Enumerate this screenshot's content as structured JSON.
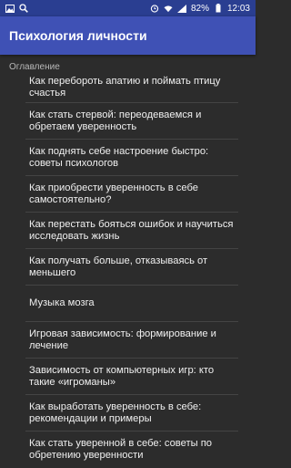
{
  "status_bar": {
    "battery": "82%",
    "time": "12:03",
    "left_icons": [
      "image-icon",
      "search-icon"
    ],
    "right_icons": [
      "alarm-icon",
      "wifi-icon",
      "signal-icon",
      "battery-icon"
    ]
  },
  "app_bar": {
    "title": "Психология личности"
  },
  "toc": {
    "header": "Оглавление",
    "items": [
      {
        "label": "Как перебороть апатию и поймать птицу счастья"
      },
      {
        "label": "Как стать стервой: переодеваемся и обретаем уверенность"
      },
      {
        "label": "Как поднять себе настроение быстро: советы психологов"
      },
      {
        "label": "Как приобрести уверенность в себе самостоятельно?"
      },
      {
        "label": "Как перестать бояться ошибок и научиться исследовать жизнь"
      },
      {
        "label": "Как получать больше, отказываясь от меньшего"
      },
      {
        "label": "Музыка мозга"
      },
      {
        "label": "Игровая зависимость: формирование и лечение"
      },
      {
        "label": "Зависимость от компьютерных игр: кто такие «игроманы»"
      },
      {
        "label": "Как выработать уверенность в себе: рекомендации и примеры"
      },
      {
        "label": "Как стать уверенной в себе: советы по обретению уверенности"
      }
    ]
  },
  "colors": {
    "status_bar": "#2a3e91",
    "app_bar": "#3f51b5",
    "background": "#2c2c2c",
    "divider": "#444444"
  }
}
